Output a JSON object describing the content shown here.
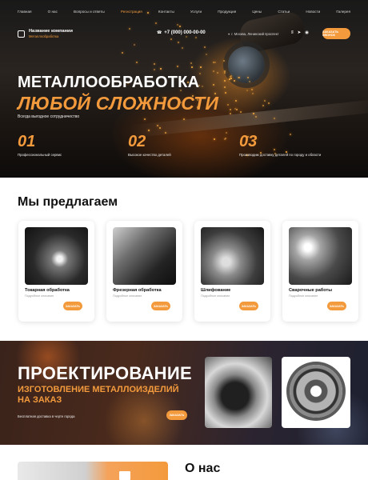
{
  "nav": {
    "items": [
      "Главная",
      "О нас",
      "Вопросы и ответы",
      "Регистрация",
      "Контакты",
      "Услуги",
      "Продукция",
      "Цены",
      "Статьи",
      "Новости",
      "Галерея"
    ],
    "active_index": 3
  },
  "header": {
    "company_name": "Название компании",
    "company_sub": "Металлообработка",
    "phone": "+7 (000) 000-00-00",
    "address": "г. Москва, Ленинский проспект",
    "cta_label": "ЗАКАЗАТЬ ЗВОНОК",
    "social_icons": [
      "vk-icon",
      "telegram-icon",
      "whatsapp-icon"
    ]
  },
  "hero": {
    "title_line1": "МЕТАЛЛООБРАБОТКА",
    "title_line2": "ЛЮБОЙ СЛОЖНОСТИ",
    "subtitle": "Всегда выгодное сотрудничество",
    "stats": [
      {
        "num": "01",
        "label": "Профессиональный сервис"
      },
      {
        "num": "02",
        "label": "Высокое качество деталей"
      },
      {
        "num": "03",
        "label": "Производим доставку деталей по городу и области"
      }
    ]
  },
  "offer": {
    "title": "Мы предлагаем",
    "cards": [
      {
        "title": "Токарная обработка",
        "subtitle": "Подробное описание",
        "button": "ЗАКАЗАТЬ"
      },
      {
        "title": "Фрезерная обработка",
        "subtitle": "Подробное описание",
        "button": "ЗАКАЗАТЬ"
      },
      {
        "title": "Шлифование",
        "subtitle": "Подробное описание",
        "button": "ЗАКАЗАТЬ"
      },
      {
        "title": "Сварочные работы",
        "subtitle": "Подробное описание",
        "button": "ЗАКАЗАТЬ"
      }
    ]
  },
  "banner": {
    "title": "ПРОЕКТИРОВАНИЕ",
    "subtitle": "ИЗГОТОВЛЕНИЕ МЕТАЛЛОИЗДЕЛИЙ НА ЗАКАЗ",
    "note": "Бесплатная доставка в черте города",
    "button": "ЗАКАЗАТЬ"
  },
  "about": {
    "title": "О нас"
  },
  "colors": {
    "accent": "#f39a3c",
    "dark": "#111111"
  }
}
